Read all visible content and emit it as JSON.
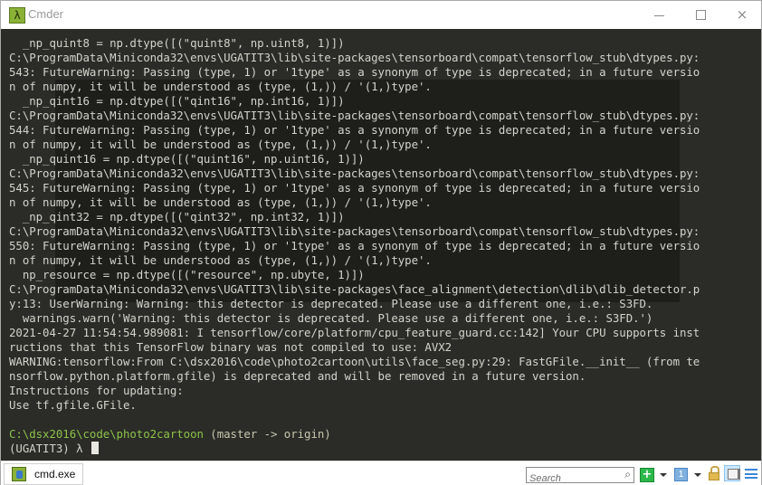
{
  "window": {
    "title": "Cmder",
    "app_icon_glyph": "λ",
    "controls": {
      "minimize": "minimize-icon",
      "maximize": "maximize-icon",
      "close": "×"
    }
  },
  "console": {
    "lines": [
      "  _np_quint8 = np.dtype([(\"quint8\", np.uint8, 1)])",
      "C:\\ProgramData\\Miniconda32\\envs\\UGATIT3\\lib\\site-packages\\tensorboard\\compat\\tensorflow_stub\\dtypes.py:",
      "543: FutureWarning: Passing (type, 1) or '1type' as a synonym of type is deprecated; in a future versio",
      "n of numpy, it will be understood as (type, (1,)) / '(1,)type'.",
      "  _np_qint16 = np.dtype([(\"qint16\", np.int16, 1)])",
      "C:\\ProgramData\\Miniconda32\\envs\\UGATIT3\\lib\\site-packages\\tensorboard\\compat\\tensorflow_stub\\dtypes.py:",
      "544: FutureWarning: Passing (type, 1) or '1type' as a synonym of type is deprecated; in a future versio",
      "n of numpy, it will be understood as (type, (1,)) / '(1,)type'.",
      "  _np_quint16 = np.dtype([(\"quint16\", np.uint16, 1)])",
      "C:\\ProgramData\\Miniconda32\\envs\\UGATIT3\\lib\\site-packages\\tensorboard\\compat\\tensorflow_stub\\dtypes.py:",
      "545: FutureWarning: Passing (type, 1) or '1type' as a synonym of type is deprecated; in a future versio",
      "n of numpy, it will be understood as (type, (1,)) / '(1,)type'.",
      "  _np_qint32 = np.dtype([(\"qint32\", np.int32, 1)])",
      "C:\\ProgramData\\Miniconda32\\envs\\UGATIT3\\lib\\site-packages\\tensorboard\\compat\\tensorflow_stub\\dtypes.py:",
      "550: FutureWarning: Passing (type, 1) or '1type' as a synonym of type is deprecated; in a future versio",
      "n of numpy, it will be understood as (type, (1,)) / '(1,)type'.",
      "  np_resource = np.dtype([(\"resource\", np.ubyte, 1)])",
      "C:\\ProgramData\\Miniconda32\\envs\\UGATIT3\\lib\\site-packages\\face_alignment\\detection\\dlib\\dlib_detector.p",
      "y:13: UserWarning: Warning: this detector is deprecated. Please use a different one, i.e.: S3FD.",
      "  warnings.warn('Warning: this detector is deprecated. Please use a different one, i.e.: S3FD.')",
      "2021-04-27 11:54:54.989081: I tensorflow/core/platform/cpu_feature_guard.cc:142] Your CPU supports inst",
      "ructions that this TensorFlow binary was not compiled to use: AVX2",
      "WARNING:tensorflow:From C:\\dsx2016\\code\\photo2cartoon\\utils\\face_seg.py:29: FastGFile.__init__ (from te",
      "nsorflow.python.platform.gfile) is deprecated and will be removed in a future version.",
      "Instructions for updating:",
      "Use tf.gfile.GFile.",
      ""
    ],
    "prompt": {
      "path": "C:\\dsx2016\\code\\photo2cartoon",
      "branch": " (master -> origin)",
      "env_prefix": "(UGATIT3) λ ",
      "input_value": ""
    },
    "colors": {
      "background": "#2b2b27",
      "text": "#d4d4cc",
      "prompt_path": "#8bc34a"
    }
  },
  "statusbar": {
    "tab_label": "cmd.exe",
    "search_placeholder": "Search",
    "search_value": "",
    "add_label": "+",
    "console_label": "1"
  }
}
